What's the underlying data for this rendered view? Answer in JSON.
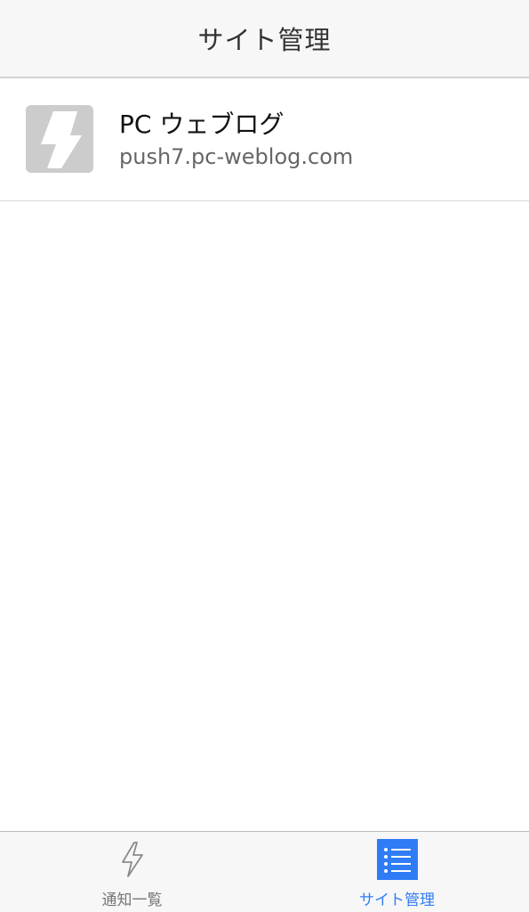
{
  "header": {
    "title": "サイト管理"
  },
  "sites": [
    {
      "name": "PC ウェブログ",
      "url": "push7.pc-weblog.com",
      "icon": "lightning-bolt-icon"
    }
  ],
  "tab_bar": {
    "tabs": [
      {
        "label": "通知一覧",
        "icon": "lightning-icon",
        "active": false
      },
      {
        "label": "サイト管理",
        "icon": "list-icon",
        "active": true
      }
    ]
  },
  "colors": {
    "accent": "#2f7cf6",
    "inactive": "#777777",
    "bar_background": "#f7f7f7",
    "site_icon_gray": "#cccccc"
  }
}
